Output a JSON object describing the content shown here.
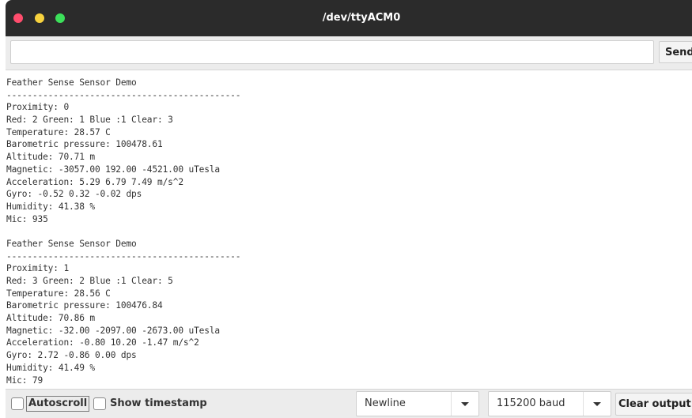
{
  "window": {
    "title": "/dev/ttyACM0",
    "colors": {
      "close": "#ff4d6d",
      "minimize": "#f7d23e",
      "maximize": "#3ce05a",
      "titlebar": "#2b2b2b"
    }
  },
  "input_row": {
    "value": "",
    "placeholder": "",
    "send_label": "Send"
  },
  "output": {
    "lines": [
      "Feather Sense Sensor Demo",
      "---------------------------------------------",
      "Proximity: 0",
      "Red: 2 Green: 1 Blue :1 Clear: 3",
      "Temperature: 28.57 C",
      "Barometric pressure: 100478.61",
      "Altitude: 70.71 m",
      "Magnetic: -3057.00 192.00 -4521.00 uTesla",
      "Acceleration: 5.29 6.79 7.49 m/s^2",
      "Gyro: -0.52 0.32 -0.02 dps",
      "Humidity: 41.38 %",
      "Mic: 935",
      "",
      "Feather Sense Sensor Demo",
      "---------------------------------------------",
      "Proximity: 1",
      "Red: 3 Green: 2 Blue :1 Clear: 5",
      "Temperature: 28.56 C",
      "Barometric pressure: 100476.84",
      "Altitude: 70.86 m",
      "Magnetic: -32.00 -2097.00 -2673.00 uTesla",
      "Acceleration: -0.80 10.20 -1.47 m/s^2",
      "Gyro: 2.72 -0.86 0.00 dps",
      "Humidity: 41.49 %",
      "Mic: 79"
    ]
  },
  "bottom_bar": {
    "autoscroll_label": "Autoscroll",
    "autoscroll_checked": false,
    "timestamp_label": "Show timestamp",
    "timestamp_checked": false,
    "line_ending": "Newline",
    "baud_rate": "115200 baud",
    "clear_label": "Clear output"
  }
}
